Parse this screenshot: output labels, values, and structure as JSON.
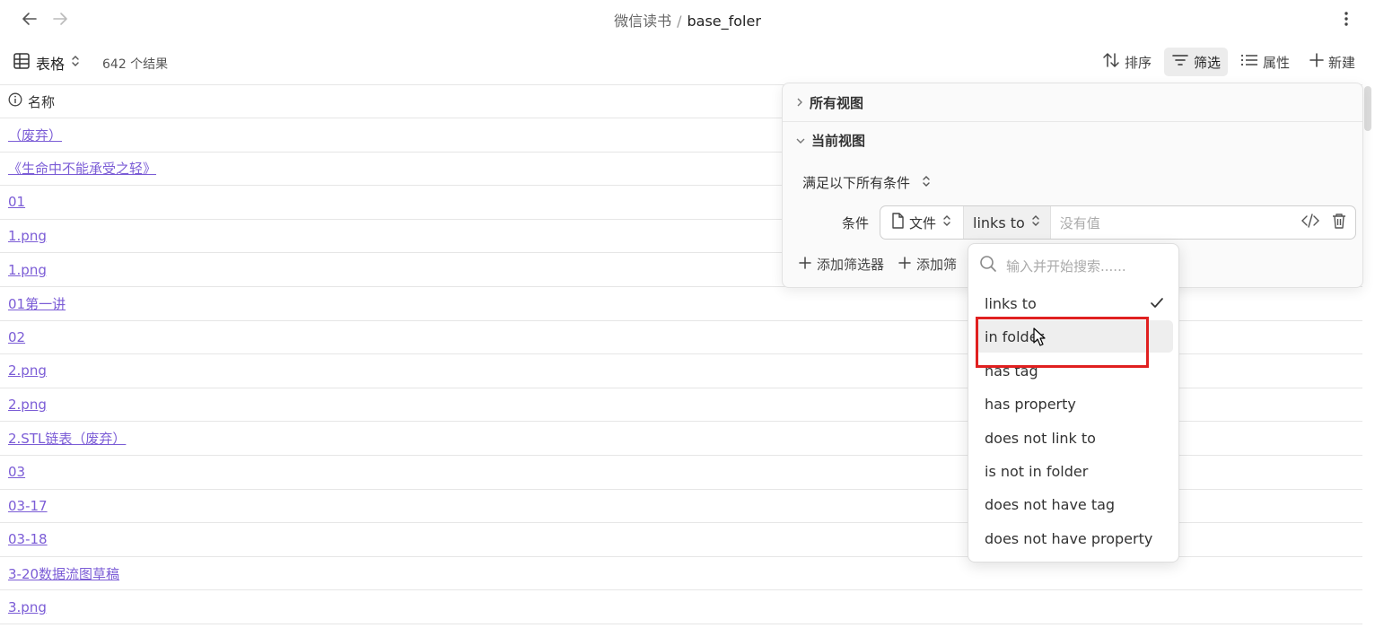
{
  "topbar": {
    "breadcrumb_parent": "微信读书",
    "breadcrumb_sep": "/",
    "breadcrumb_current": "base_foler"
  },
  "toolbar": {
    "view_label": "表格",
    "result_count": "642 个结果",
    "sort_label": "排序",
    "filter_label": "筛选",
    "properties_label": "属性",
    "new_label": "新建"
  },
  "table": {
    "header": "名称",
    "rows": [
      "（废弃）",
      "《生命中不能承受之轻》",
      "01",
      "1.png",
      "1.png",
      "01第一讲",
      "02",
      "2.png",
      "2.png",
      "2.STL链表（废弃）",
      "03",
      "03-17",
      "03-18",
      "3-20数据流图草稿",
      "3.png"
    ]
  },
  "filter_panel": {
    "all_views": "所有视图",
    "current_view": "当前视图",
    "mode": "满足以下所有条件",
    "condition_label": "条件",
    "field": "文件",
    "operator": "links to",
    "value_placeholder": "没有值",
    "add_filter": "添加筛选器",
    "add_filter_group": "添加筛"
  },
  "dropdown": {
    "search_placeholder": "输入并开始搜索......",
    "items": [
      "links to",
      "in folder",
      "has tag",
      "has property",
      "does not link to",
      "is not in folder",
      "does not have tag",
      "does not have property"
    ],
    "selected": "links to",
    "hovered": "in folder"
  },
  "colors": {
    "link": "#7b5cd6",
    "highlight": "#e02020"
  }
}
